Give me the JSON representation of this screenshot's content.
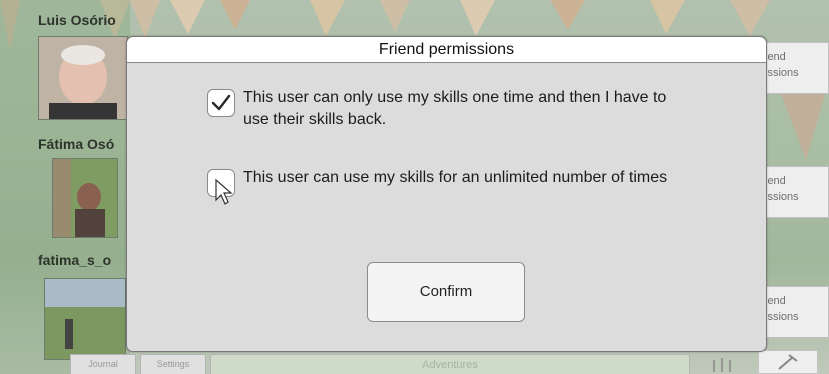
{
  "dialog": {
    "title": "Friend permissions",
    "options": [
      {
        "label": "This user can only use my skills one time and then I have to use their skills back.",
        "checked": true
      },
      {
        "label": "This user can use my skills for an unlimited number of times",
        "checked": false
      }
    ],
    "confirm_label": "Confirm"
  },
  "friends": [
    {
      "name": "Luis Osório"
    },
    {
      "name": "Fátima Osó"
    },
    {
      "name": "fatima_s_o"
    }
  ],
  "permission_buttons": [
    {
      "label_line1": "iend",
      "label_line2": "issions"
    },
    {
      "label_line1": "iend",
      "label_line2": "issions"
    },
    {
      "label_line1": "iend",
      "label_line2": "issions"
    }
  ],
  "bottom_bar": {
    "journal_label": "Journal",
    "settings_label": "Settings",
    "adventures_label": "Adventures"
  },
  "colors": {
    "dialog_bg": "#dcdcdc",
    "title_bg": "#ffffff",
    "scene_green": "#95ad8f"
  },
  "icons": {
    "check": "check-icon",
    "cursor": "mouse-pointer-icon",
    "tool": "hanger-icon"
  }
}
